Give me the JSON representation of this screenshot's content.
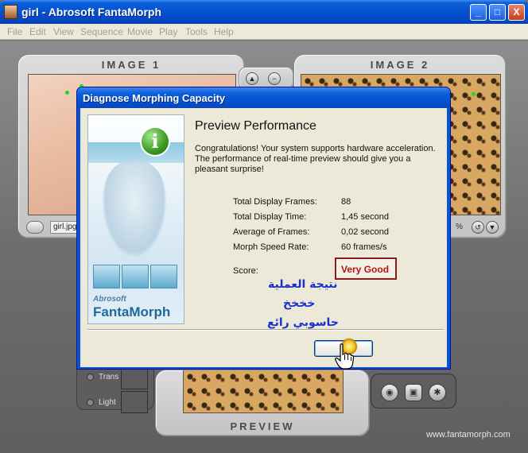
{
  "window": {
    "title": "girl - Abrosoft FantaMorph",
    "minimize": "_",
    "maximize": "□",
    "close": "X"
  },
  "menu": [
    "File",
    "Edit",
    "View",
    "Sequence",
    "Movie",
    "Play",
    "Tools",
    "Help"
  ],
  "panels": {
    "image1_label": "IMAGE 1",
    "image2_label": "IMAGE 2",
    "preview_label": "PREVIEW",
    "file_name": "girl.jpg",
    "trans_label": "Trans",
    "light_label": "Light",
    "website": "www.fantamorph.com",
    "image2_suffix": "%"
  },
  "dialog": {
    "title": "Diagnose Morphing Capacity",
    "heading": "Preview Performance",
    "message": "Congratulations! Your system supports hardware acceleration. The performance of real-time preview should give you a pleasant surprise!",
    "stats": [
      {
        "label": "Total Display Frames:",
        "value": "88"
      },
      {
        "label": "Total Display Time:",
        "value": "1,45 second"
      },
      {
        "label": "Average of Frames:",
        "value": "0,02 second"
      },
      {
        "label": "Morph Speed Rate:",
        "value": "60 frames/s"
      }
    ],
    "score_label": "Score:",
    "score_value": "Very Good",
    "brand_small": "Abrosoft",
    "brand_big": "FantaMorph",
    "info_icon": "i"
  },
  "overlay_text": {
    "line1": "نتيجة العملية",
    "line2": "خخخخ",
    "line3": "حاسوبي رائع"
  },
  "icons": {
    "app": "app-icon",
    "info": "info-icon",
    "cursor": "hand-cursor-icon"
  },
  "colors": {
    "titlebar": "#0450d0",
    "score_text": "#b41414",
    "score_border": "#8b1c1c",
    "overlay_text": "#1b2fd0",
    "banner_brand": "#1d6a9a"
  }
}
